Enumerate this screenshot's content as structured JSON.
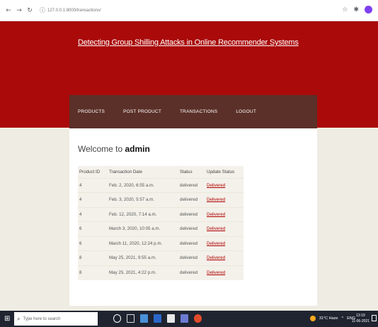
{
  "browser": {
    "url": "127.0.0.1:8000/transactions/",
    "back_icon": "arrow-left-icon",
    "forward_icon": "arrow-right-icon",
    "reload_icon": "reload-icon"
  },
  "header": {
    "title": "Detecting Group Shilling Attacks in Online Recommender Systems",
    "bg_color": "#aa0a0a"
  },
  "nav": {
    "items": [
      {
        "label": "PRODUCTS"
      },
      {
        "label": "POST PRODUCT"
      },
      {
        "label": "TRANSACTIONS"
      },
      {
        "label": "LOGOUT"
      }
    ]
  },
  "main": {
    "welcome_text": "Welcome to",
    "username": "admin",
    "table": {
      "headers": [
        "Product ID",
        "Transaction Date",
        "Status",
        "Update Status"
      ],
      "rows": [
        {
          "product_id": "4",
          "date": "Feb. 2, 2020, 6:55 a.m.",
          "status": "delivered",
          "update": "Delivered"
        },
        {
          "product_id": "4",
          "date": "Feb. 3, 2020, 5:57 a.m.",
          "status": "delivered",
          "update": "Delivered"
        },
        {
          "product_id": "4",
          "date": "Feb. 12, 2020, 7:14 a.m.",
          "status": "delivered",
          "update": "Delivered"
        },
        {
          "product_id": "6",
          "date": "March 3, 2020, 10:05 a.m.",
          "status": "delivered",
          "update": "Delivered"
        },
        {
          "product_id": "6",
          "date": "March 11, 2020, 12:24 p.m.",
          "status": "delivered",
          "update": "Delivered"
        },
        {
          "product_id": "8",
          "date": "May 25, 2021, 9:55 a.m.",
          "status": "delivered",
          "update": "Delivered"
        },
        {
          "product_id": "8",
          "date": "May 25, 2021, 4:22 p.m.",
          "status": "delivered",
          "update": "Delivered"
        }
      ]
    }
  },
  "taskbar": {
    "search_placeholder": "Type here to search",
    "weather": "31°C Haze",
    "language": "ENG",
    "time": "13:19",
    "date": "11-06-2021"
  }
}
